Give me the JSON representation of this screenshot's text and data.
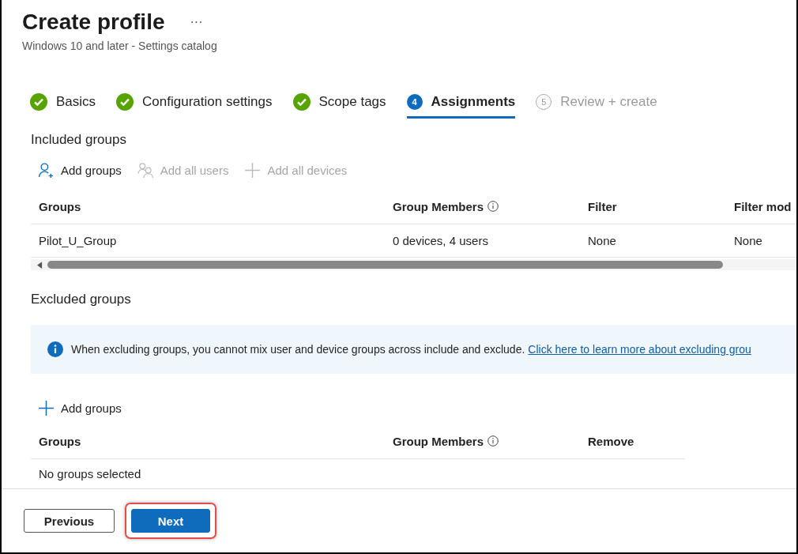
{
  "header": {
    "title": "Create profile",
    "more": "···",
    "subtitle": "Windows 10 and later - Settings catalog"
  },
  "steps": [
    {
      "label": "Basics",
      "kind": "done",
      "selected": false
    },
    {
      "label": "Configuration settings",
      "kind": "done",
      "selected": false
    },
    {
      "label": "Scope tags",
      "kind": "done",
      "selected": false
    },
    {
      "label": "Assignments",
      "kind": "current",
      "number": "4",
      "selected": true
    },
    {
      "label": "Review + create",
      "kind": "upcoming",
      "number": "5",
      "selected": false
    }
  ],
  "included": {
    "heading": "Included groups",
    "actions": [
      {
        "label": "Add groups",
        "kind": "add-group",
        "disabled": false
      },
      {
        "label": "Add all users",
        "kind": "users",
        "disabled": true
      },
      {
        "label": "Add all devices",
        "kind": "plus",
        "disabled": true
      }
    ],
    "columns": [
      {
        "label": "Groups",
        "info": false
      },
      {
        "label": "Group Members",
        "info": true
      },
      {
        "label": "Filter",
        "info": false
      },
      {
        "label": "Filter mod",
        "info": false
      }
    ],
    "rows": [
      [
        "Pilot_U_Group",
        "0 devices, 4 users",
        "None",
        "None"
      ]
    ]
  },
  "excluded": {
    "heading": "Excluded groups",
    "notice": {
      "text": "When excluding groups, you cannot mix user and device groups across include and exclude.",
      "link": "Click here to learn more about excluding grou"
    },
    "actions": [
      {
        "label": "Add groups",
        "kind": "plus",
        "disabled": false
      }
    ],
    "columns": [
      {
        "label": "Groups",
        "info": false
      },
      {
        "label": "Group Members",
        "info": true
      },
      {
        "label": "Remove",
        "info": false
      }
    ],
    "empty": "No groups selected"
  },
  "footer": {
    "buttons": [
      {
        "label": "Previous",
        "kind": "secondary",
        "highlighted": false
      },
      {
        "label": "Next",
        "kind": "primary",
        "highlighted": true
      }
    ]
  }
}
